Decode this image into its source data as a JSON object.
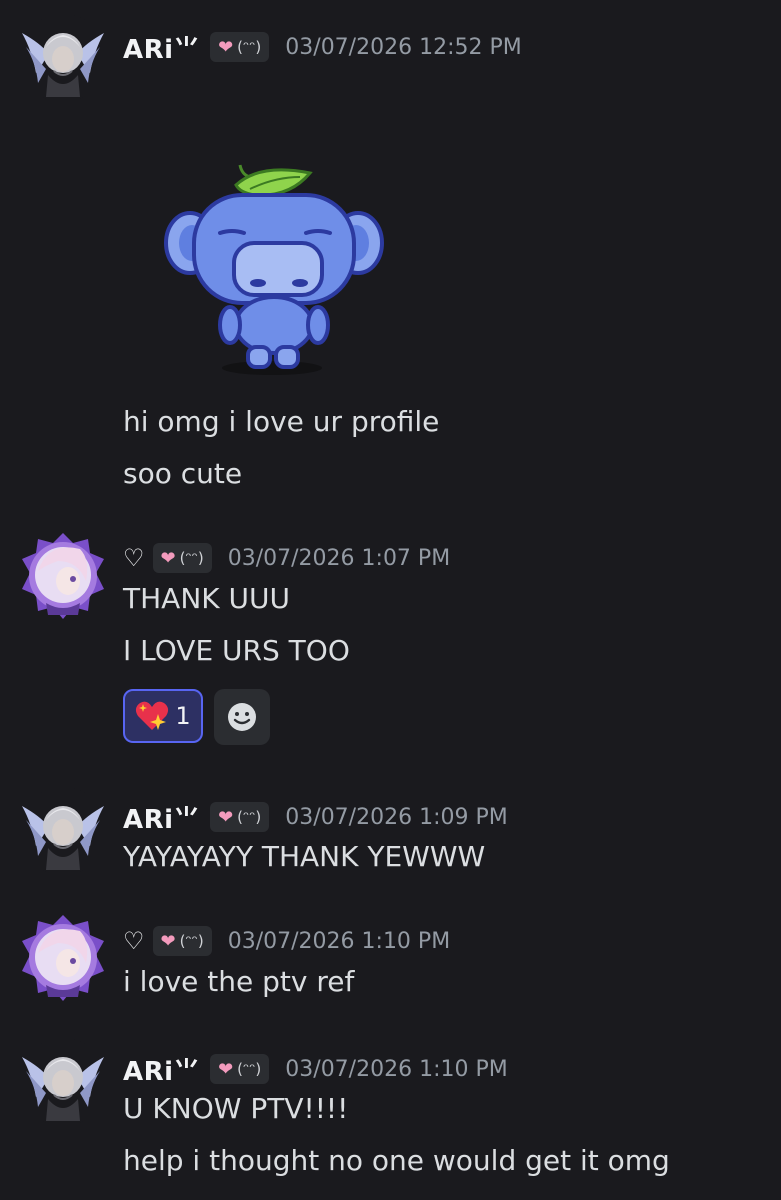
{
  "messages": [
    {
      "author": "ARi⺌",
      "tag": "(ᵔᵔ)",
      "timestamp": "03/07/2026 12:52 PM",
      "sticker": "wumpus-with-leaf",
      "lines": [
        "hi omg i love ur profile",
        "soo cute"
      ]
    },
    {
      "author": "♡",
      "tag": "(ᵔᵔ)",
      "timestamp": "03/07/2026 1:07 PM",
      "lines": [
        "THANK UUU",
        "I LOVE URS TOO"
      ],
      "reaction": {
        "emoji": "sparkling-heart-icon",
        "count": "1"
      }
    },
    {
      "author": "ARi⺌",
      "tag": "(ᵔᵔ)",
      "timestamp": "03/07/2026 1:09 PM",
      "lines": [
        "YAYAYAYY THANK YEWWW"
      ]
    },
    {
      "author": "♡",
      "tag": "(ᵔᵔ)",
      "timestamp": "03/07/2026 1:10 PM",
      "lines": [
        "i love the ptv ref"
      ]
    },
    {
      "author": "ARi⺌",
      "tag": "(ᵔᵔ)",
      "timestamp": "03/07/2026 1:10 PM",
      "lines": [
        "U KNOW PTV!!!!",
        "help i thought no one would get it omg"
      ]
    }
  ],
  "colors": {
    "background": "#1a1a1e",
    "text": "#dbdee1",
    "timestamp": "#949ba4",
    "reaction_border": "#5865f2"
  }
}
